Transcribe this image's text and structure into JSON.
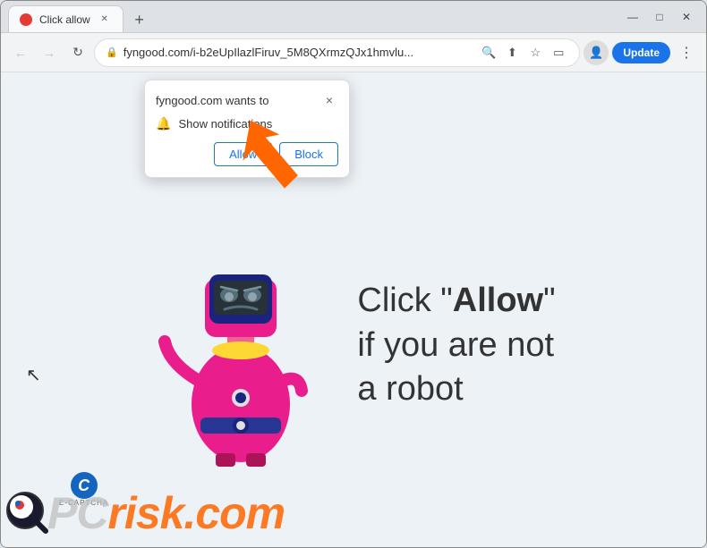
{
  "browser": {
    "tab": {
      "title": "Click allow",
      "favicon_color": "#e53935"
    },
    "url": "fyngood.com/i-b2eUpIlazlFiruv_5M8QXrmzQJx1hmvlu...",
    "update_label": "Update",
    "new_tab_label": "+",
    "window_controls": {
      "minimize": "—",
      "maximize": "□",
      "close": "✕"
    }
  },
  "popup": {
    "site": "fyngood.com wants to",
    "notification_label": "Show notifications",
    "allow_label": "Allow",
    "block_label": "Block",
    "close_label": "×"
  },
  "page": {
    "captcha_line1": "Click \"",
    "captcha_allow": "Allow",
    "captcha_line2": "\"",
    "captcha_line3": "if you are not",
    "captcha_line4": "a robot",
    "ecaptcha_label": "E-CAPTCHA",
    "brand_pc": "PC",
    "brand_risk": "risk.com"
  }
}
